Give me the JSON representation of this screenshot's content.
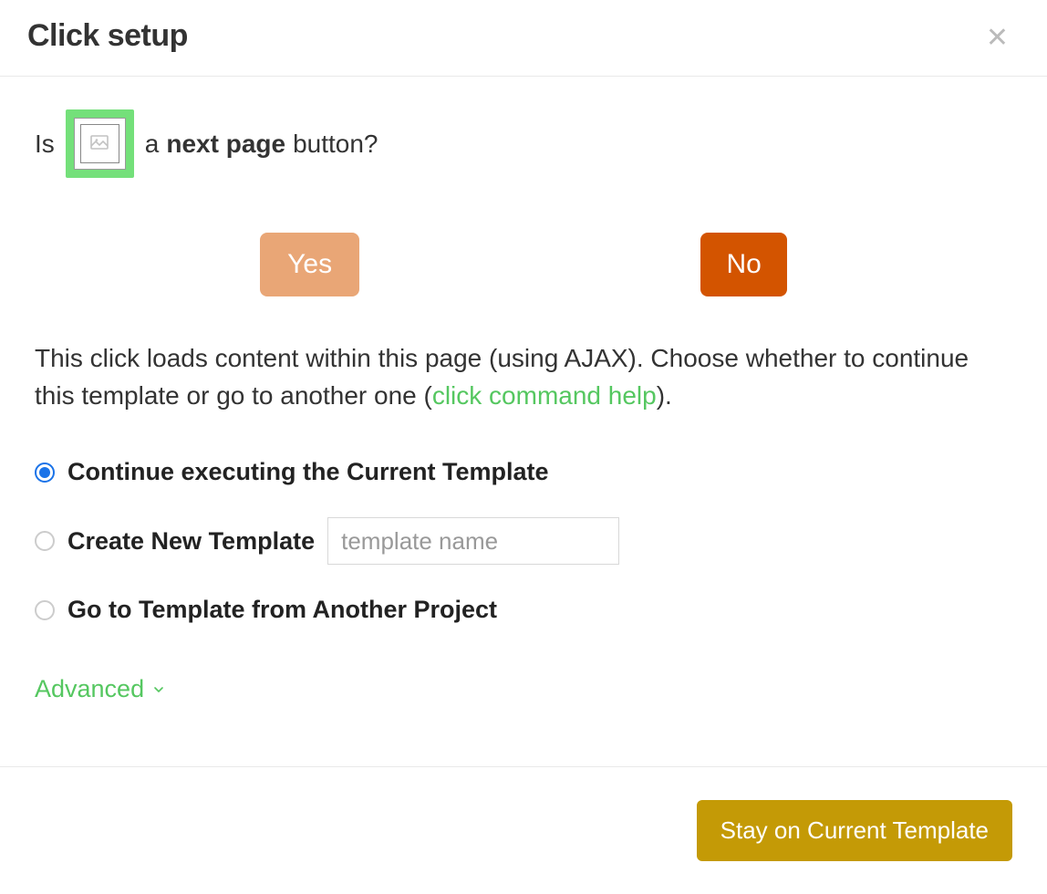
{
  "header": {
    "title": "Click setup"
  },
  "question": {
    "prefix": "Is",
    "bold": "next page",
    "article": "a",
    "suffix": "button?"
  },
  "buttons": {
    "yes": "Yes",
    "no": "No"
  },
  "desc": {
    "part1": "This click loads content within this page (using AJAX). Choose whether to continue this template or go to another one (",
    "link": "click command help",
    "part2": ")."
  },
  "options": {
    "continue": "Continue executing the Current Template",
    "create": "Create New Template",
    "create_placeholder": "template name",
    "goto": "Go to Template from Another Project"
  },
  "advanced": "Advanced",
  "footer": {
    "primary": "Stay on Current Template"
  }
}
